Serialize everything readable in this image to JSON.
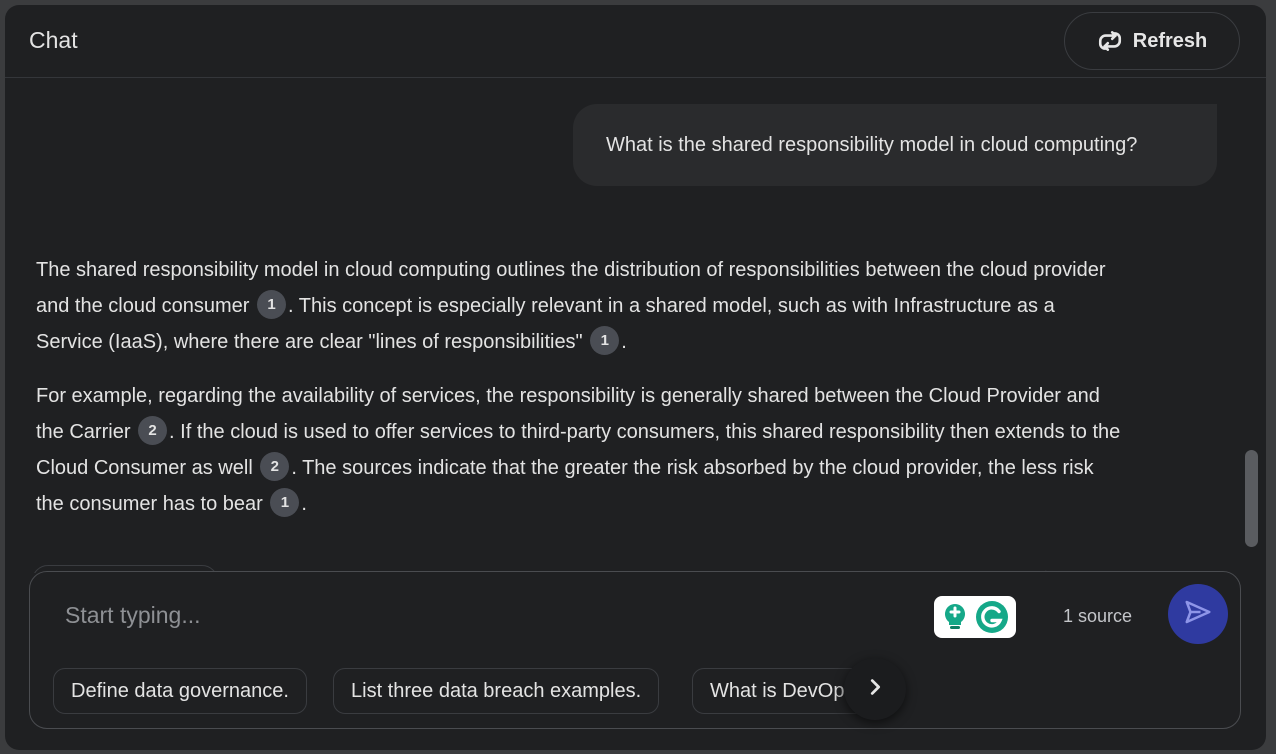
{
  "header": {
    "title": "Chat",
    "refresh_label": "Refresh",
    "refresh_icon": "refresh-icon"
  },
  "conversation": {
    "user_message": "What is the shared responsibility model in cloud computing?",
    "answer": {
      "p1": {
        "s1": "The shared responsibility model in cloud computing outlines the distribution of responsibilities between the cloud provider and the cloud consumer",
        "c1": "1",
        "s2": ". This concept is especially relevant in a shared model, such as with Infrastructure as a Service (IaaS), where there are clear \"lines of responsibilities\"",
        "c2": "1",
        "s3": "."
      },
      "p2": {
        "s1": "For example, regarding the availability of services, the responsibility is generally shared between the Cloud Provider and the Carrier",
        "c1": "2",
        "s2": ". If the cloud is used to offer services to third-party consumers, this shared responsibility then extends to the Cloud Consumer as well",
        "c2": "2",
        "s3": ". The sources indicate that the greater the risk absorbed by the cloud provider, the less risk the consumer has to bear",
        "c3": "1",
        "s4": "."
      }
    }
  },
  "composer": {
    "placeholder": "Start typing...",
    "source_count": "1 source",
    "send_icon": "send-icon",
    "grammarly_icon": "grammarly-icon",
    "suggestions": [
      "Define data governance.",
      "List three data breach examples.",
      "What is DevOps?"
    ],
    "next_icon": "chevron-right-icon"
  },
  "colors": {
    "panel_bg": "#1f2022",
    "page_bg": "#3b3c3e",
    "user_bubble": "#2a2b2d",
    "citation_bg": "#4a4d54",
    "send_button": "#2f3aa0",
    "grammarly_green": "#15c39a"
  }
}
